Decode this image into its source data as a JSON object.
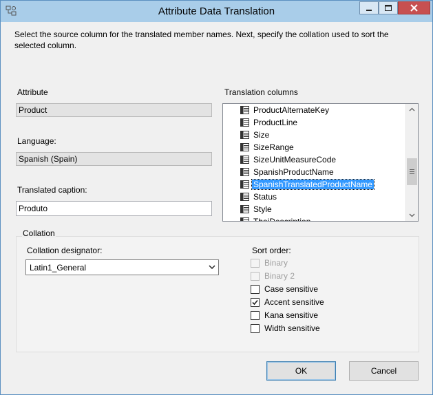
{
  "window": {
    "title": "Attribute Data Translation"
  },
  "description": "Select the source column for the translated member names.  Next, specify the collation used to sort the selected column.",
  "attribute": {
    "label": "Attribute",
    "value": "Product"
  },
  "language": {
    "label": "Language:",
    "value": "Spanish (Spain)"
  },
  "translated_caption": {
    "label": "Translated caption:",
    "value": "Produto"
  },
  "translation_columns": {
    "label": "Translation columns",
    "items": [
      "ProductAlternateKey",
      "ProductLine",
      "Size",
      "SizeRange",
      "SizeUnitMeasureCode",
      "SpanishProductName",
      "SpanishTranslatedProductName",
      "Status",
      "Style",
      "ThaiDescription"
    ],
    "selected": "SpanishTranslatedProductName"
  },
  "collation": {
    "group_label": "Collation",
    "designator_label": "Collation designator:",
    "designator_value": "Latin1_General",
    "sort_order_label": "Sort order:",
    "options": [
      {
        "label": "Binary",
        "checked": false,
        "enabled": false
      },
      {
        "label": "Binary 2",
        "checked": false,
        "enabled": false
      },
      {
        "label": "Case sensitive",
        "checked": false,
        "enabled": true
      },
      {
        "label": "Accent sensitive",
        "checked": true,
        "enabled": true
      },
      {
        "label": "Kana sensitive",
        "checked": false,
        "enabled": true
      },
      {
        "label": "Width sensitive",
        "checked": false,
        "enabled": true
      }
    ]
  },
  "buttons": {
    "ok": "OK",
    "cancel": "Cancel"
  },
  "colors": {
    "titlebar": "#a9cde9",
    "close": "#c75050",
    "selection": "#3399ff"
  }
}
